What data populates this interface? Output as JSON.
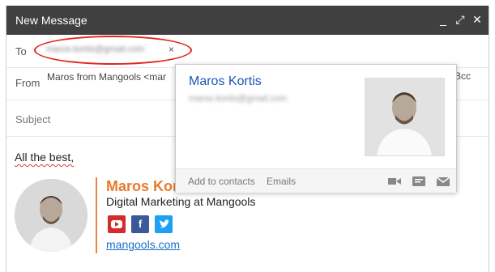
{
  "window": {
    "title": "New Message",
    "controls": {
      "minimize": "_",
      "popout": "⤢",
      "close": "✕"
    }
  },
  "compose": {
    "to_label": "To",
    "recipient_email": "maros.kortis@gmail.com",
    "chip_remove": "×",
    "from_label": "From",
    "from_value": "Maros from Mangools <mar",
    "bcc_label": "Bcc",
    "subject_placeholder": "Subject",
    "body_text": "All the best,"
  },
  "signature": {
    "name": "Maros Kortis",
    "role": "Digital Marketing at Mangools",
    "link": "mangools.com",
    "social": [
      "youtube",
      "facebook",
      "twitter"
    ]
  },
  "contact_card": {
    "name": "Maros Kortis",
    "email": "maros.kortis@gmail.com",
    "add_label": "Add to contacts",
    "emails_label": "Emails"
  },
  "colors": {
    "titlebar": "#404040",
    "accent": "#e87a2e",
    "link": "#1a6fc9",
    "highlight_oval": "#e0261c",
    "youtube": "#d62b2b",
    "facebook": "#3b5998",
    "twitter": "#1da1f2"
  }
}
